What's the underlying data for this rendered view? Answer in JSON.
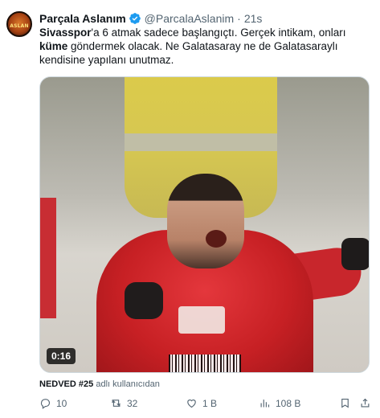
{
  "author": {
    "display_name": "Parçala Aslanım",
    "handle": "@ParcalaAslanim",
    "time": "21s",
    "verified": true,
    "avatar_text": "ASLAN"
  },
  "tweet": {
    "text_part1": "Sivasspor",
    "text_part2": "'a 6 atmak sadece başlangıçtı. Gerçek intikam, onları ",
    "text_part3": "küme",
    "text_part4": " göndermek olacak. Ne Galatasaray ne de Galatasaraylı kendisine yapılanı unutmaz."
  },
  "media": {
    "duration": "0:16"
  },
  "attribution": {
    "user": "NEDVED #25",
    "suffix": "adlı kullanıcıdan"
  },
  "actions": {
    "reply_count": "10",
    "retweet_count": "32",
    "like_count": "1 B",
    "views_count": "108 B"
  },
  "colors": {
    "text": "#0f1419",
    "secondary": "#536471",
    "verified": "#1d9bf0"
  }
}
